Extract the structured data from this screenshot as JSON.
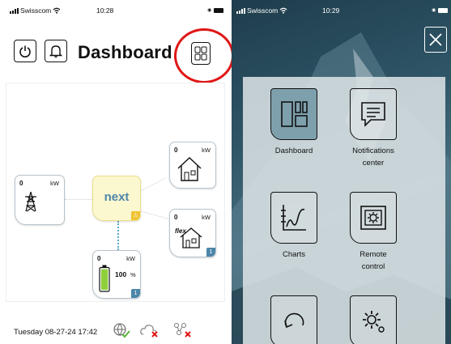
{
  "left": {
    "status": {
      "carrier": "Swisscom",
      "time": "10:28"
    },
    "header": {
      "title": "Dashboard"
    },
    "flow": {
      "grid": {
        "value": "0",
        "unit": "kW"
      },
      "center": {
        "label": "next",
        "badge": ""
      },
      "house": {
        "value": "0",
        "unit": "kW"
      },
      "flex": {
        "value": "0",
        "unit": "kW",
        "tag": "flex",
        "badge": "1"
      },
      "battery": {
        "value": "0",
        "unit": "kW",
        "percent": "100",
        "percent_unit": "%",
        "badge": "1"
      }
    },
    "footer": {
      "datetime": "Tuesday 08-27-24 17:42"
    }
  },
  "right": {
    "status": {
      "carrier": "Swisscom",
      "time": "10:29"
    },
    "menu": [
      {
        "label": "Dashboard",
        "icon": "dashboard-icon",
        "active": true
      },
      {
        "label": "Notifications center",
        "icon": "notifications-icon",
        "active": false
      },
      {
        "label": "Charts",
        "icon": "charts-icon",
        "active": false
      },
      {
        "label": "Remote control",
        "icon": "remote-control-icon",
        "active": false
      },
      {
        "label": "",
        "icon": "refresh-icon",
        "active": false
      },
      {
        "label": "",
        "icon": "settings-icon",
        "active": false
      }
    ]
  },
  "colors": {
    "accent": "#4c86a9",
    "highlight": "#e01515",
    "next_bg": "#fbf7cf",
    "badge_yellow": "#f1c232"
  }
}
